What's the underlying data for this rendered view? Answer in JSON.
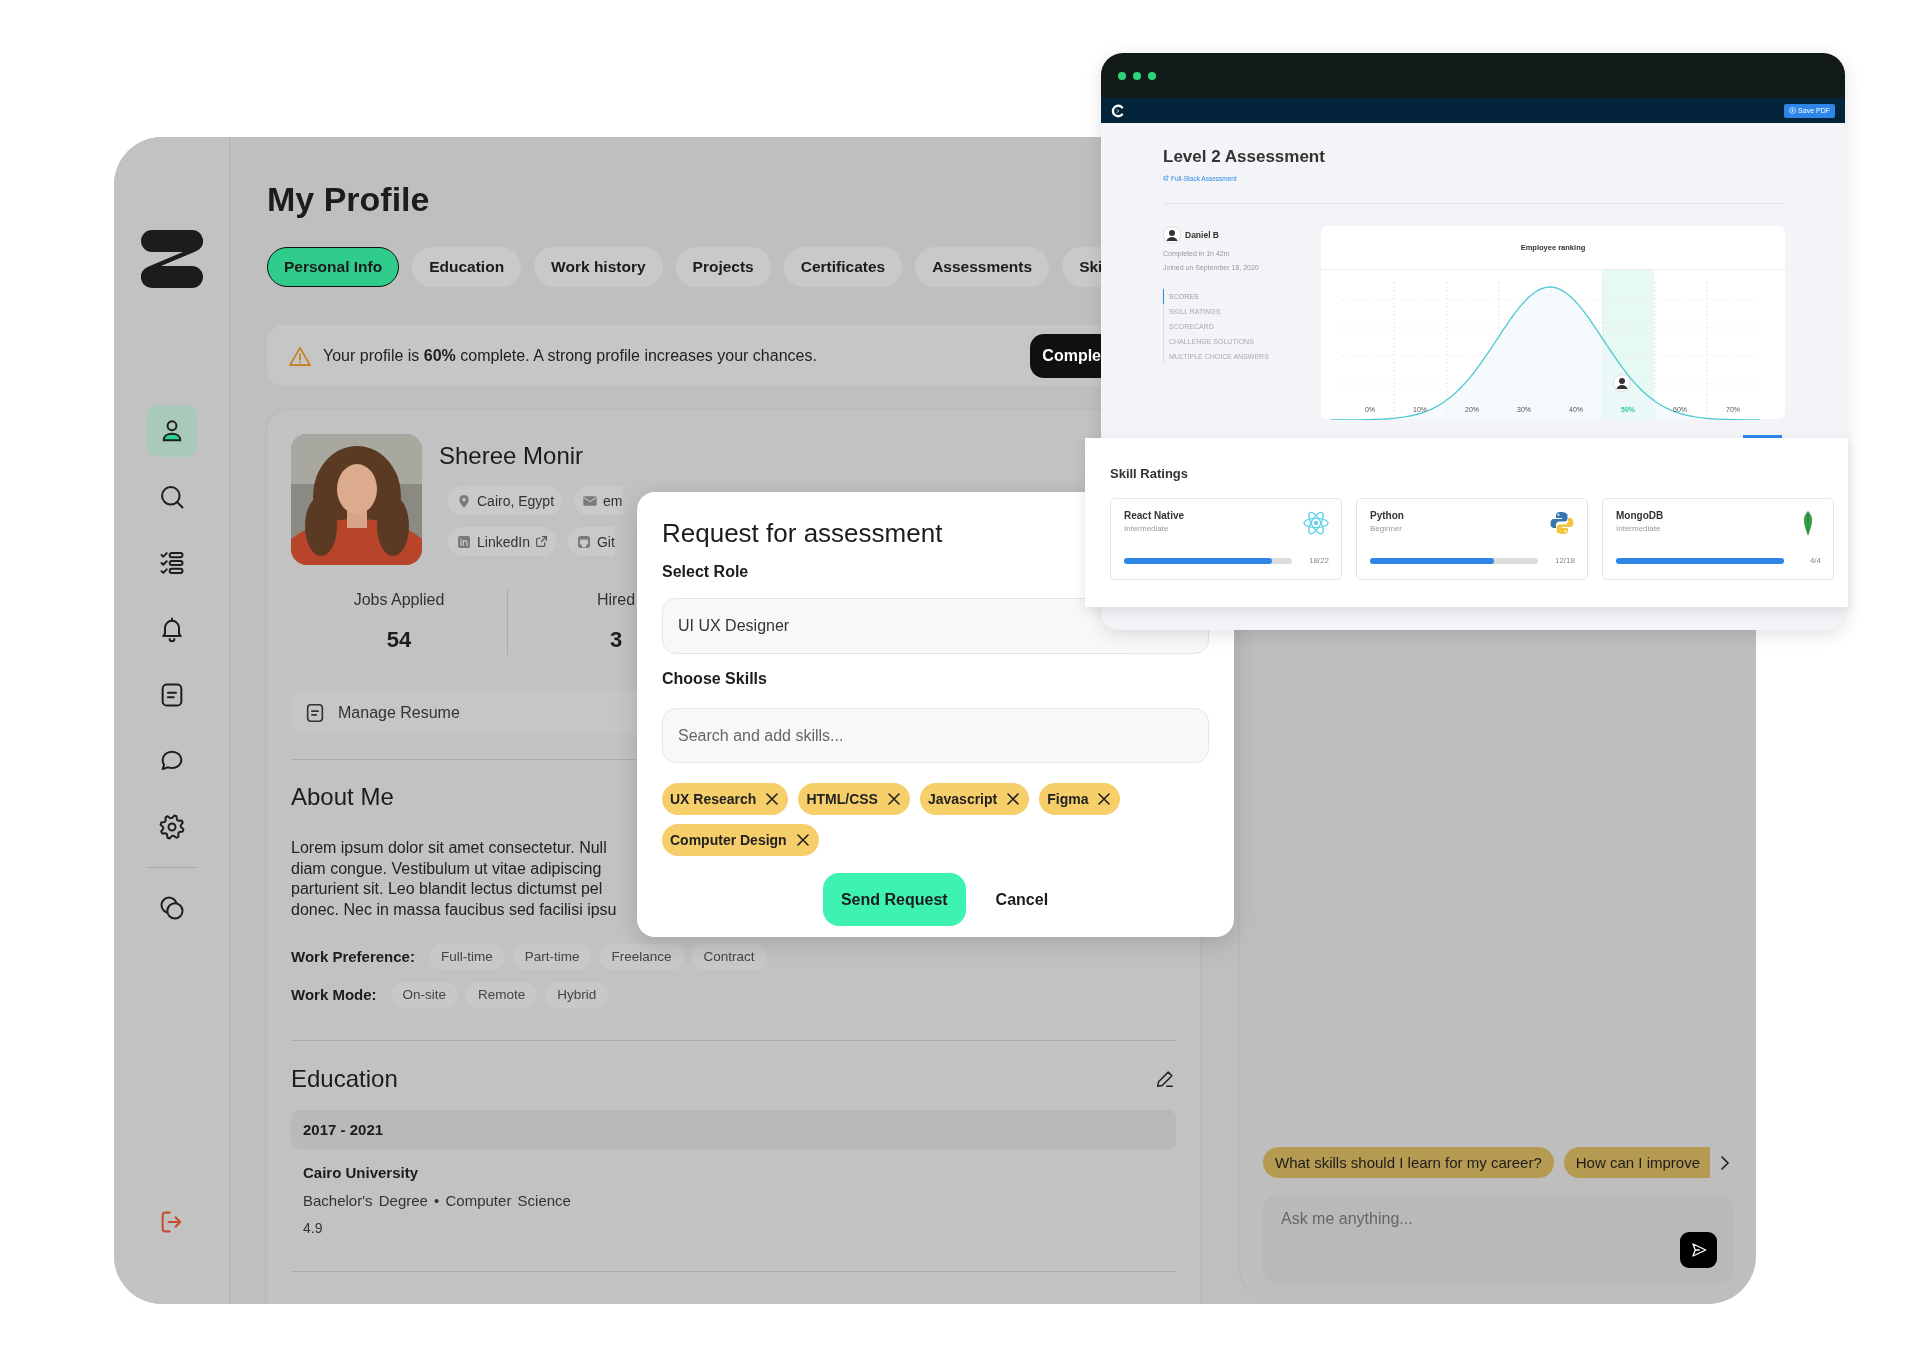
{
  "sidebar": {
    "groups": [
      {
        "items": [
          {
            "selected": true
          },
          {
            "selected": false
          },
          {
            "selected": false
          },
          {
            "selected": false
          },
          {
            "selected": false
          },
          {
            "selected": false
          },
          {
            "selected": false
          }
        ]
      },
      {
        "items": [
          {
            "selected": false
          }
        ]
      }
    ]
  },
  "page": {
    "title": "My Profile"
  },
  "tabs": [
    {
      "label": "Personal Info",
      "selected": true
    },
    {
      "label": "Education",
      "selected": false
    },
    {
      "label": "Work history",
      "selected": false
    },
    {
      "label": "Projects",
      "selected": false
    },
    {
      "label": "Certificates",
      "selected": false
    },
    {
      "label": "Assessments",
      "selected": false
    },
    {
      "label": "Ski",
      "selected": false
    }
  ],
  "banner": {
    "message": "Your profile is **60%** complete. A strong profile increases your chances.",
    "button": "Comple"
  },
  "profile": {
    "name": "Sheree Monir",
    "contact_rows": [
      [
        "Cairo, Egypt",
        "em"
      ],
      [
        "LinkedIn",
        "Git"
      ]
    ],
    "stats": [
      {
        "label": "Jobs Applied",
        "value": "54"
      },
      {
        "label": "Hired",
        "value": "3"
      }
    ],
    "resume_button": "Manage Resume"
  },
  "about": {
    "title": "About Me",
    "lines": [
      "Lorem ipsum dolor sit amet consectetur. Null",
      "diam congue. Vestibulum ut vitae adipiscing",
      "parturient sit. Leo blandit lectus dictumst pel",
      "donec. Nec in massa faucibus sed facilisi ipsu"
    ],
    "preferences": [
      {
        "label": "Work Preference:",
        "options": [
          "Full-time",
          "Part-time",
          "Freelance",
          "Contract"
        ]
      },
      {
        "label": "Work Mode:",
        "options": [
          "On-site",
          "Remote",
          "Hybrid"
        ]
      }
    ]
  },
  "education": {
    "title": "Education",
    "entries": [
      {
        "years": "2017 - 2021",
        "school": "Cairo University",
        "degree": "Bachelor's Degree • Computer Science",
        "grade": "4.9"
      }
    ]
  },
  "chat": {
    "suggestions": [
      "What skills should I learn for my career?",
      "How can I improve"
    ],
    "input": {
      "placeholder": "Ask me anything..."
    }
  },
  "modal": {
    "title": "Request for assessment",
    "role_label": "Select Role",
    "role_value": "UI UX Designer",
    "skills_label": "Choose Skills",
    "skills_search": {
      "placeholder": "Search and add skills..."
    },
    "tags": [
      "UX Research",
      "HTML/CSS",
      "Javascript",
      "Figma",
      "Computer Design"
    ],
    "buttons": [
      {
        "label": "Send Request",
        "kind": "primary"
      },
      {
        "label": "Cancel",
        "kind": "plain"
      }
    ]
  },
  "assessment_window": {
    "save_button": "Save PDF",
    "title": "Level 2 Assessment",
    "link": "Full-Stack Assessment",
    "candidate": {
      "name": "Daniel B",
      "completed": "Completed in 1h 42m",
      "joined": "Joined on September 18, 2020"
    },
    "nav": [
      {
        "label": "SCORES",
        "selected": true
      },
      {
        "label": "SKILL RATINGS",
        "selected": false
      },
      {
        "label": "SCORECARD",
        "selected": false
      },
      {
        "label": "CHALLENGE SOLUTIONS",
        "selected": false
      },
      {
        "label": "MULTIPLE CHOICE ANSWERS",
        "selected": false
      }
    ],
    "ranking": {
      "title": "Employee ranking",
      "x_labels": [
        {
          "label": "0%",
          "selected": false
        },
        {
          "label": "10%",
          "selected": false
        },
        {
          "label": "20%",
          "selected": false
        },
        {
          "label": "30%",
          "selected": false
        },
        {
          "label": "40%",
          "selected": false
        },
        {
          "label": "50%",
          "selected": true
        },
        {
          "label": "60%",
          "selected": false
        },
        {
          "label": "70%",
          "selected": false
        }
      ]
    }
  },
  "skill_ratings": {
    "title": "Skill Ratings",
    "skills": [
      {
        "name": "React Native",
        "level_text": "Intermediate",
        "level": 0.88,
        "reading": "18/22"
      },
      {
        "name": "Python",
        "level_text": "Beginner",
        "level": 0.74,
        "reading": "12/18"
      },
      {
        "name": "MongoDB",
        "level_text": "Intermediate",
        "level": 1,
        "reading": "4/4"
      }
    ]
  }
}
